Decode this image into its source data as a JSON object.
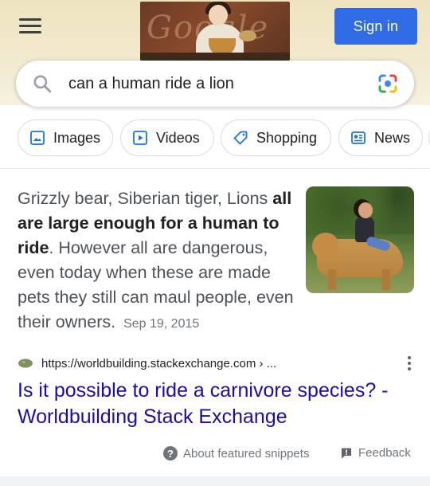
{
  "header": {
    "menu_icon": "hamburger-menu-icon",
    "doodle_icon": "google-doodle-logo",
    "signin_label": "Sign in",
    "accent": "#2f6ce5"
  },
  "search": {
    "query": "can a human ride a lion",
    "search_icon": "magnifier-icon",
    "lens_icon": "google-lens-camera-icon"
  },
  "chips": [
    {
      "label": "Images",
      "icon": "image-icon"
    },
    {
      "label": "Videos",
      "icon": "play-icon"
    },
    {
      "label": "Shopping",
      "icon": "tag-icon"
    },
    {
      "label": "News",
      "icon": "newspaper-icon"
    }
  ],
  "snippet": {
    "text_1": "Grizzly bear, Siberian tiger, Lions",
    "bold": "all are large enough for a human to ride",
    "text_2": ". However all are dangerous, even today when these are made pets they still can maul people, even their owners.",
    "date": "Sep 19, 2015",
    "thumbnail_icon": "woman-riding-liger-photo"
  },
  "result": {
    "url": "https://worldbuilding.stackexchange.com › ...",
    "favicon": "worldbuilding-globe-favicon",
    "title": "Is it possible to ride a carnivore species? - Worldbuilding Stack Exchange",
    "title_color": "#1a0dab"
  },
  "footer": {
    "about_label": "About featured snippets",
    "feedback_label": "Feedback"
  }
}
